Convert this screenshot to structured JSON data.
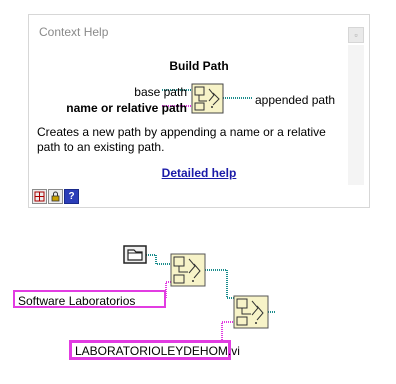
{
  "help_window": {
    "title": "Context Help",
    "function_name": "Build Path",
    "terminals": {
      "base_path": "base path",
      "name_or_relative_path": "name or relative path",
      "appended_path": "appended path"
    },
    "description": "Creates a new path by appending a name or a relative path to an existing path.",
    "link_label": "Detailed help",
    "close_icon": "close-icon",
    "toolbar_icons": [
      "show-optional-terminals-icon",
      "lock-icon",
      "help-icon"
    ],
    "help_button_label": "?"
  },
  "block_diagram": {
    "constants": {
      "software_path": "Software Laboratorios",
      "file_name": "LABORATORIOLEYDEHOM.vi"
    },
    "folder_constant_icon": "folder-path-constant-icon",
    "nodes": [
      "build-path-node",
      "build-path-node"
    ]
  },
  "colors": {
    "path_wire": "#1b8c8c",
    "string_wire": "#e23ce2",
    "node_fill": "#f7f3c8",
    "link": "#1a1aa8"
  }
}
